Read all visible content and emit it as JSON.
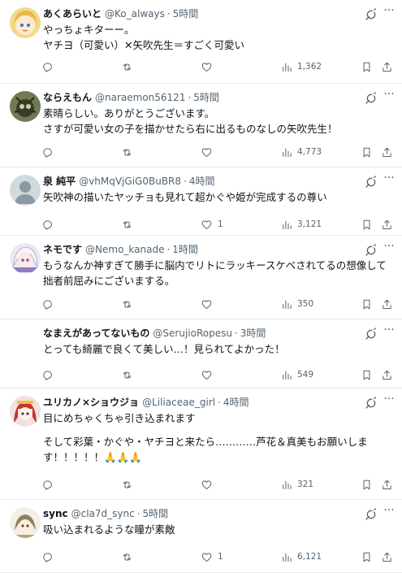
{
  "tweets": [
    {
      "name": "あくあらいと",
      "handle": "@Ko_always",
      "time": "5時間",
      "lines": [
        "やっちょキターー。",
        "ヤチヨ（可愛い）✕矢吹先生＝すごく可愛い"
      ],
      "replies": "",
      "retweets": "",
      "likes": "",
      "views": "1,362"
    },
    {
      "name": "ならえもん",
      "handle": "@naraemon56121",
      "time": "5時間",
      "lines": [
        "素晴らしい。ありがとうございます。",
        "さすが可愛い女の子を描かせたら右に出るものなしの矢吹先生！"
      ],
      "replies": "",
      "retweets": "",
      "likes": "",
      "views": "4,773"
    },
    {
      "name": "泉 純平",
      "handle": "@vhMqVjGiG0BuBR8",
      "time": "4時間",
      "lines": [
        "矢吹神の描いたヤッチョも見れて超かぐや姫が完成するの尊い"
      ],
      "replies": "",
      "retweets": "",
      "likes": "1",
      "views": "3,121"
    },
    {
      "name": "ネモです",
      "handle": "@Nemo_kanade",
      "time": "1時間",
      "lines": [
        "もうなんか神すぎて勝手に脳内でリトにラッキースケベされてるの想像して",
        "拙者前屈みにございまする。"
      ],
      "replies": "",
      "retweets": "",
      "likes": "",
      "views": "350"
    },
    {
      "name": "なまえがあってないもの",
      "handle": "@SerujioRopesu",
      "time": "3時間",
      "lines": [
        "とっても綺麗で良くて美しい…！見られてよかった！"
      ],
      "replies": "",
      "retweets": "",
      "likes": "",
      "views": "549"
    },
    {
      "name": "ユリカノ×ショウジョ",
      "handle": "@Liliaceae_girl",
      "time": "4時間",
      "lines": [
        "目にめちゃくちゃ引き込まれます",
        "",
        "そして彩葉・かぐや・ヤチヨと来たら…………芦花＆真美もお願いしま",
        "す！！！！！🙏🙏🙏"
      ],
      "replies": "",
      "retweets": "",
      "likes": "",
      "views": "321"
    },
    {
      "name": "sync",
      "handle": "@cla7d_sync",
      "time": "5時間",
      "lines": [
        "吸い込まれるような瞳が素敵"
      ],
      "replies": "",
      "retweets": "",
      "likes": "1",
      "views": "6,121"
    }
  ],
  "icons": {
    "reply": "reply-icon",
    "retweet": "retweet-icon",
    "like": "like-icon",
    "views": "views-icon",
    "bookmark": "bookmark-icon",
    "share": "share-icon",
    "grok": "grok-icon",
    "more": "more-icon"
  },
  "colors": {
    "text": "#0f1419",
    "secondary": "#536471",
    "divider": "#e6ecf0"
  }
}
